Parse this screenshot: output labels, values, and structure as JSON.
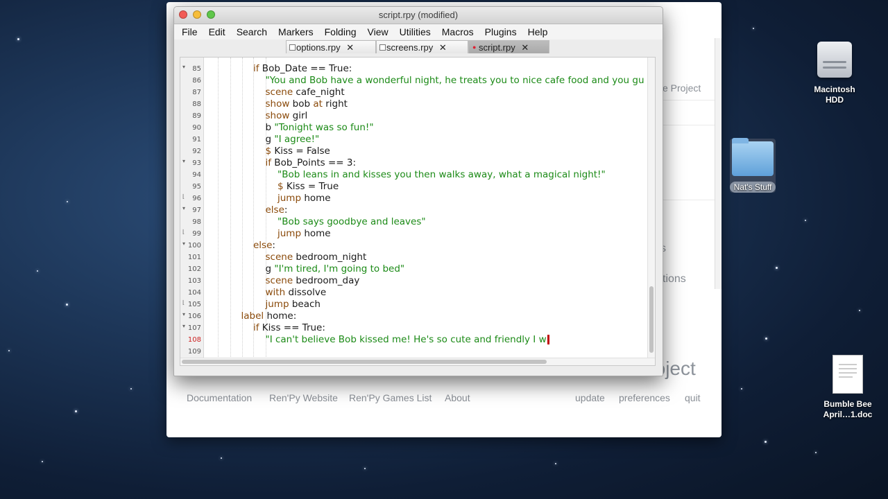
{
  "launcher": {
    "project_partial": "e Project",
    "partial_s": "s",
    "partial_options": "tions",
    "launch_heading": "Launch Project",
    "nav_left": [
      "Documentation",
      "Ren'Py Website",
      "Ren'Py Games List",
      "About"
    ],
    "nav_right": [
      "update",
      "preferences",
      "quit"
    ]
  },
  "editor": {
    "title": "script.rpy (modified)",
    "menus": [
      "File",
      "Edit",
      "Search",
      "Markers",
      "Folding",
      "View",
      "Utilities",
      "Macros",
      "Plugins",
      "Help"
    ],
    "tabs": [
      {
        "label": "options.rpy",
        "close": "✕"
      },
      {
        "label": "screens.rpy",
        "close": "✕"
      },
      {
        "label": "script.rpy",
        "close": "✕"
      }
    ],
    "current_line": "108",
    "lines": [
      {
        "n": "85",
        "indent": 0,
        "fold": "▾",
        "parts": [
          {
            "t": "if",
            "k": "kw"
          },
          {
            "t": " Bob_Date == True:"
          }
        ]
      },
      {
        "n": "86",
        "indent": 1,
        "fold": "",
        "parts": [
          {
            "t": "\"You and Bob have a wonderful night, he treats you to nice cafe food and you gu",
            "k": "str"
          }
        ]
      },
      {
        "n": "87",
        "indent": 1,
        "fold": "",
        "parts": [
          {
            "t": "scene",
            "k": "kw"
          },
          {
            "t": " cafe_night"
          }
        ]
      },
      {
        "n": "88",
        "indent": 1,
        "fold": "",
        "parts": [
          {
            "t": "show",
            "k": "kw"
          },
          {
            "t": " bob "
          },
          {
            "t": "at",
            "k": "kw"
          },
          {
            "t": " right"
          }
        ]
      },
      {
        "n": "89",
        "indent": 1,
        "fold": "",
        "parts": [
          {
            "t": "show",
            "k": "kw"
          },
          {
            "t": " girl"
          }
        ]
      },
      {
        "n": "90",
        "indent": 1,
        "fold": "",
        "parts": [
          {
            "t": "b "
          },
          {
            "t": "\"Tonight was so fun!\"",
            "k": "str"
          }
        ]
      },
      {
        "n": "91",
        "indent": 1,
        "fold": "",
        "parts": [
          {
            "t": "g "
          },
          {
            "t": "\"I agree!\"",
            "k": "str"
          }
        ]
      },
      {
        "n": "92",
        "indent": 1,
        "fold": "",
        "parts": [
          {
            "t": "$",
            "k": "kw"
          },
          {
            "t": " Kiss = False"
          }
        ]
      },
      {
        "n": "93",
        "indent": 1,
        "fold": "▾",
        "parts": [
          {
            "t": "if",
            "k": "kw"
          },
          {
            "t": " Bob_Points == 3:"
          }
        ]
      },
      {
        "n": "94",
        "indent": 2,
        "fold": "",
        "parts": [
          {
            "t": "\"Bob leans in and kisses you then walks away, what a magical night!\"",
            "k": "str"
          }
        ]
      },
      {
        "n": "95",
        "indent": 2,
        "fold": "",
        "parts": [
          {
            "t": "$",
            "k": "kw"
          },
          {
            "t": " Kiss = True"
          }
        ]
      },
      {
        "n": "96",
        "indent": 2,
        "fold": "⌊",
        "parts": [
          {
            "t": "jump",
            "k": "kw"
          },
          {
            "t": " home"
          }
        ]
      },
      {
        "n": "97",
        "indent": 1,
        "fold": "▾",
        "parts": [
          {
            "t": "else",
            "k": "kw"
          },
          {
            "t": ":"
          }
        ]
      },
      {
        "n": "98",
        "indent": 2,
        "fold": "",
        "parts": [
          {
            "t": "\"Bob says goodbye and leaves\"",
            "k": "str"
          }
        ]
      },
      {
        "n": "99",
        "indent": 2,
        "fold": "⌊",
        "parts": [
          {
            "t": "jump",
            "k": "kw"
          },
          {
            "t": " home"
          }
        ]
      },
      {
        "n": "100",
        "indent": 0,
        "fold": "▾",
        "parts": [
          {
            "t": "else",
            "k": "kw"
          },
          {
            "t": ":"
          }
        ]
      },
      {
        "n": "101",
        "indent": 1,
        "fold": "",
        "parts": [
          {
            "t": "scene",
            "k": "kw"
          },
          {
            "t": " bedroom_night"
          }
        ]
      },
      {
        "n": "102",
        "indent": 1,
        "fold": "",
        "parts": [
          {
            "t": "g "
          },
          {
            "t": "\"I'm tired, I'm going to bed\"",
            "k": "str"
          }
        ]
      },
      {
        "n": "103",
        "indent": 1,
        "fold": "",
        "parts": [
          {
            "t": "scene",
            "k": "kw"
          },
          {
            "t": " bedroom_day"
          }
        ]
      },
      {
        "n": "104",
        "indent": 1,
        "fold": "",
        "parts": [
          {
            "t": "with",
            "k": "kw"
          },
          {
            "t": " dissolve"
          }
        ]
      },
      {
        "n": "105",
        "indent": 1,
        "fold": "⌊",
        "parts": [
          {
            "t": "jump",
            "k": "kw"
          },
          {
            "t": " beach"
          }
        ]
      },
      {
        "n": "106",
        "indent": -1,
        "fold": "▾",
        "parts": [
          {
            "t": "label",
            "k": "kw"
          },
          {
            "t": " home:"
          }
        ]
      },
      {
        "n": "107",
        "indent": 0,
        "fold": "▾",
        "parts": [
          {
            "t": "if",
            "k": "kw"
          },
          {
            "t": " Kiss == True:"
          }
        ]
      },
      {
        "n": "108",
        "indent": 1,
        "fold": "",
        "parts": [
          {
            "t": "\"I can't believe Bob kissed me! He's so cute and friendly I w",
            "k": "str"
          }
        ]
      },
      {
        "n": "109",
        "indent": 1,
        "fold": "",
        "parts": []
      }
    ]
  },
  "desktop": {
    "icons": [
      {
        "label": "Macintosh HDD",
        "icon": "hard-drive-icon"
      },
      {
        "label": "Nat's Stuff",
        "icon": "folder-icon"
      },
      {
        "label": "Bumble Bee April…1.doc",
        "icon": "document-icon"
      }
    ]
  },
  "colors": {
    "keyword": "#8a4a0a",
    "string": "#1b8a16",
    "current_line_number": "#cc2222",
    "cursor": "#c00000"
  }
}
